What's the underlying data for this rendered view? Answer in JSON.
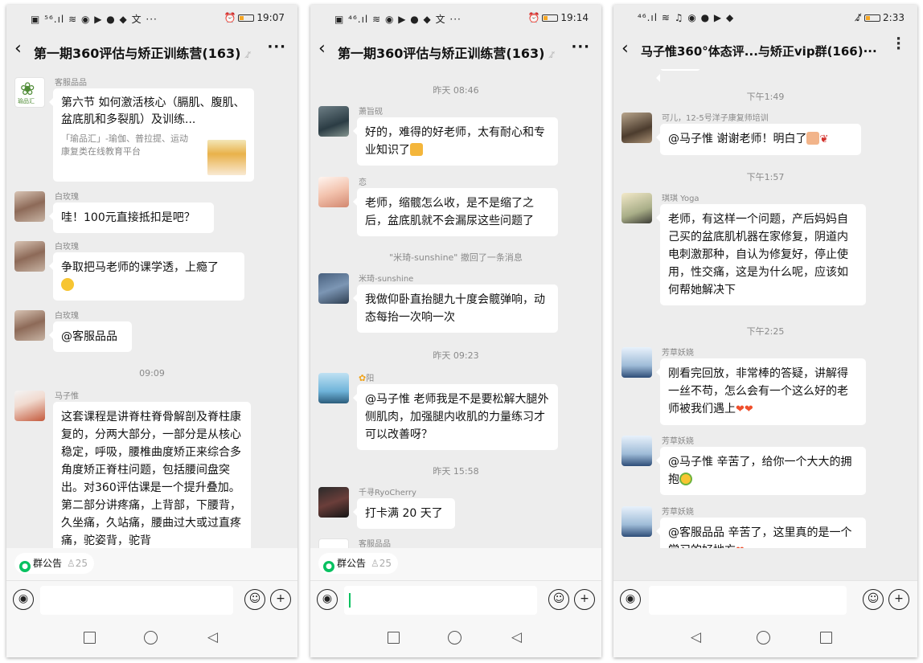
{
  "phones": [
    {
      "status": {
        "left": "▣ ⁵⁶.ıl ≋ ◉ ▶ ● ◆ 文 ···",
        "time": "19:07"
      },
      "title": "第一期360评估与矫正训练营(163)",
      "messages": [
        {
          "sender": "客服品品",
          "card_title": "第六节 如何激活核心（膈肌、腹肌、盆底肌和多裂肌）及训练...",
          "card_desc": "「瑜品汇」-瑜伽、普拉提、运动康复类在线教育平台",
          "logo_text": "瑜品汇"
        },
        {
          "sender": "白玫瑰",
          "text": "哇！100元直接抵扣是吧？"
        },
        {
          "sender": "白玫瑰",
          "text": "争取把马老师的课学透，上瘾了"
        },
        {
          "sender": "白玫瑰",
          "text": "@客服品品"
        },
        {
          "sender": "马子惟",
          "text": "这套课程是讲脊柱脊骨解剖及脊柱康复的，分两大部分，一部分是从核心稳定，呼吸，腰椎曲度矫正来综合多角度矫正脊柱问题，包括腰间盘突出。对360评估课是一个提升叠加。第二部分讲疼痛，上背部，下腰背，久坐痛，久站痛，腰曲过大或过直疼痛，驼姿背，驼背"
        }
      ],
      "timestamps": [
        "09:09"
      ],
      "notice": {
        "label": "群公告",
        "count": "25"
      }
    },
    {
      "status": {
        "left": "▣ ⁴⁶.ıl ≋ ◉ ▶ ● ◆ 文 ···",
        "time": "19:14"
      },
      "title": "第一期360评估与矫正训练营(163)",
      "timestamps": [
        "昨天 08:46",
        "昨天 09:23",
        "昨天 15:58"
      ],
      "recall": "\"米琦-sunshine\" 撤回了一条消息",
      "messages": [
        {
          "sender": "萧旨砚",
          "text": "好的，难得的好老师，太有耐心和专业知识了"
        },
        {
          "sender": "恋",
          "text": "老师，缩髋怎么收，是不是缩了之后，盆底肌就不会漏尿这些问题了"
        },
        {
          "sender": "米琦-sunshine",
          "text": "我做仰卧直抬腿九十度会髋弹响，动态每抬一次响一次"
        },
        {
          "sender": "阳",
          "text": "@马子惟  老师我是不是要松解大腿外侧肌肉，加强腿内收肌的力量练习才可以改善呀？"
        },
        {
          "sender": "千寻RyoCherry",
          "text": "打卡满 20 天了"
        },
        {
          "sender": "客服品品"
        }
      ],
      "notice": {
        "label": "群公告",
        "count": "25"
      }
    },
    {
      "status": {
        "left": "⁴⁶.ıl ≋ ♫ ◉ ● ▶ ◆",
        "time": "2:33"
      },
      "title": "马子惟360°体态评...与矫正vip群(166)···",
      "timestamps": [
        "下午1:49",
        "下午1:57",
        "下午2:25"
      ],
      "messages": [
        {
          "sender": "可儿，12-5号洋子康复师培训",
          "text": "@马子惟  谢谢老师！明白了"
        },
        {
          "sender": "琪琪 Yoga",
          "text": "老师，有这样一个问题，产后妈妈自己买的盆底肌机器在家修复，阴道内电刺激那种，自认为修复好，停止使用，性交痛，这是为什么呢，应该如何帮她解决下"
        },
        {
          "sender": "芳草妖娆",
          "text": "刚看完回放，非常棒的答疑，讲解得一丝不苟，怎么会有一个这么好的老师被我们遇上"
        },
        {
          "sender": "芳草妖娆",
          "text": "@马子惟  辛苦了，给你一个大大的拥抱"
        },
        {
          "sender": "芳草妖娆",
          "text": "@客服品品  辛苦了，这里真的是一个学习的好地方"
        }
      ]
    }
  ]
}
